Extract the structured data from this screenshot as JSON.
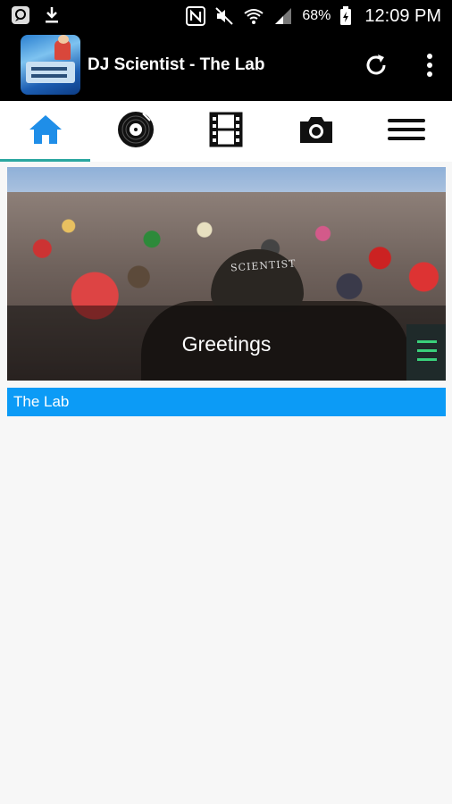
{
  "status_bar": {
    "battery_percent": "68%",
    "time": "12:09 PM",
    "icons": [
      "messenger-icon",
      "download-icon",
      "nfc-icon",
      "mute-icon",
      "wifi-icon",
      "signal-icon",
      "battery-icon"
    ]
  },
  "app_bar": {
    "title": "DJ Scientist - The Lab",
    "actions": [
      "refresh-icon",
      "overflow-menu-icon"
    ]
  },
  "tabs": [
    {
      "name": "home",
      "icon": "home-icon",
      "active": true,
      "color": "#1f8ee8"
    },
    {
      "name": "music",
      "icon": "vinyl-record-icon",
      "active": false
    },
    {
      "name": "video",
      "icon": "film-strip-icon",
      "active": false
    },
    {
      "name": "photos",
      "icon": "camera-icon",
      "active": false
    },
    {
      "name": "menu",
      "icon": "hamburger-menu-icon",
      "active": false
    }
  ],
  "hero": {
    "caption": "Greetings",
    "cap_text": "SCIENTIST"
  },
  "section": {
    "title": "The Lab"
  },
  "colors": {
    "accent_tab_indicator": "#2aa7a0",
    "section_bar": "#0c9bf6",
    "home_icon": "#1f8ee8"
  }
}
